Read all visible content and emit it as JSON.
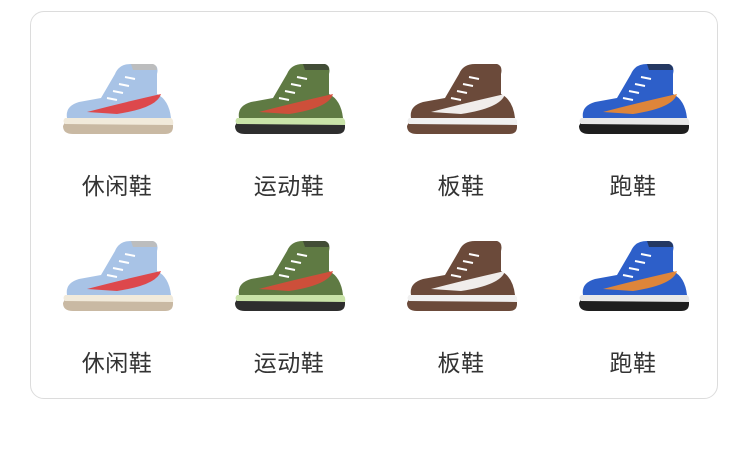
{
  "categories": [
    {
      "label": "休闲鞋",
      "icon": "sneaker-light-blue-icon",
      "colors": {
        "upper": "#a8c3e6",
        "accent": "#e23b3b",
        "sole": "#f1eadb",
        "outsole": "#c9b9a3"
      }
    },
    {
      "label": "运动鞋",
      "icon": "sneaker-olive-green-icon",
      "colors": {
        "upper": "#5f7a43",
        "accent": "#d94a3a",
        "sole": "#c9e3a8",
        "outsole": "#2e2e2e"
      }
    },
    {
      "label": "板鞋",
      "icon": "sneaker-brown-white-icon",
      "colors": {
        "upper": "#6b4a3a",
        "accent": "#ffffff",
        "sole": "#f0f0f0",
        "outsole": "#6b4a3a"
      }
    },
    {
      "label": "跑鞋",
      "icon": "sneaker-royal-blue-icon",
      "colors": {
        "upper": "#2d5fc9",
        "accent": "#f28a2a",
        "sole": "#e8e8e8",
        "outsole": "#1e1e1e"
      }
    },
    {
      "label": "休闲鞋",
      "icon": "sneaker-light-blue-icon",
      "colors": {
        "upper": "#a8c3e6",
        "accent": "#e23b3b",
        "sole": "#f1eadb",
        "outsole": "#c9b9a3"
      }
    },
    {
      "label": "运动鞋",
      "icon": "sneaker-olive-green-icon",
      "colors": {
        "upper": "#5f7a43",
        "accent": "#d94a3a",
        "sole": "#c9e3a8",
        "outsole": "#2e2e2e"
      }
    },
    {
      "label": "板鞋",
      "icon": "sneaker-brown-white-icon",
      "colors": {
        "upper": "#6b4a3a",
        "accent": "#ffffff",
        "sole": "#f0f0f0",
        "outsole": "#6b4a3a"
      }
    },
    {
      "label": "跑鞋",
      "icon": "sneaker-royal-blue-icon",
      "colors": {
        "upper": "#2d5fc9",
        "accent": "#f28a2a",
        "sole": "#e8e8e8",
        "outsole": "#1e1e1e"
      }
    }
  ]
}
